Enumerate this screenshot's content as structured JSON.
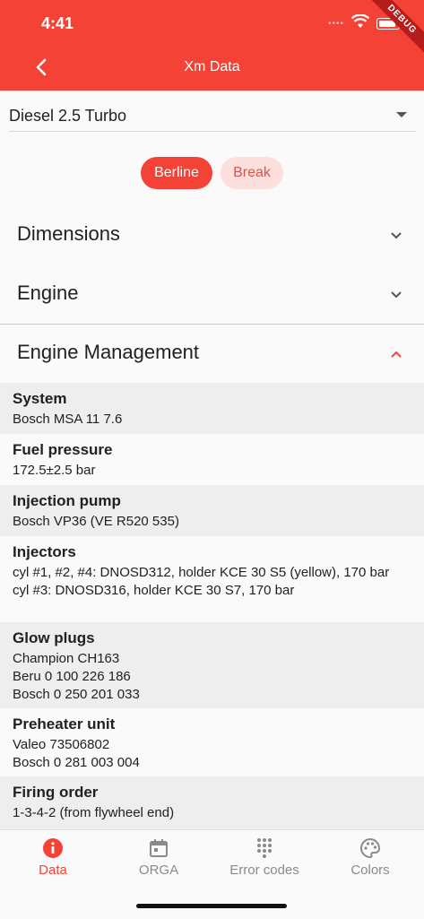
{
  "status": {
    "time": "4:41",
    "debug_label": "DEBUG"
  },
  "appbar": {
    "title": "Xm Data"
  },
  "engine_select": {
    "value": "Diesel 2.5 Turbo"
  },
  "body_types": {
    "active": "Berline",
    "inactive": "Break"
  },
  "sections": {
    "dimensions": "Dimensions",
    "engine": "Engine",
    "engine_management": "Engine Management"
  },
  "specs": [
    {
      "label": "System",
      "values": [
        "Bosch MSA 11 7.6"
      ]
    },
    {
      "label": "Fuel pressure",
      "values": [
        "172.5±2.5 bar"
      ]
    },
    {
      "label": "Injection pump",
      "values": [
        "Bosch VP36 (VE R520 535)"
      ]
    },
    {
      "label": "Injectors",
      "values": [
        "cyl #1, #2, #4: DNOSD312, holder KCE 30 S5 (yellow), 170 bar",
        "cyl #3: DNOSD316, holder KCE 30 S7, 170 bar"
      ]
    },
    {
      "label": "Glow plugs",
      "values": [
        "Champion CH163",
        "Beru 0 100 226 186",
        "Bosch 0 250 201 033"
      ]
    },
    {
      "label": "Preheater unit",
      "values": [
        "Valeo 73506802",
        "Bosch 0 281 003 004"
      ]
    },
    {
      "label": "Firing order",
      "values": [
        "1-3-4-2 (from flywheel end)"
      ]
    }
  ],
  "nav": [
    {
      "label": "Data",
      "icon": "info-icon",
      "active": true
    },
    {
      "label": "ORGA",
      "icon": "calendar-icon",
      "active": false
    },
    {
      "label": "Error codes",
      "icon": "dialpad-icon",
      "active": false
    },
    {
      "label": "Colors",
      "icon": "palette-icon",
      "active": false
    }
  ],
  "colors": {
    "accent": "#f44336",
    "chip_inactive_bg": "#fde0de",
    "row_alt_bg": "#eeeeee"
  }
}
